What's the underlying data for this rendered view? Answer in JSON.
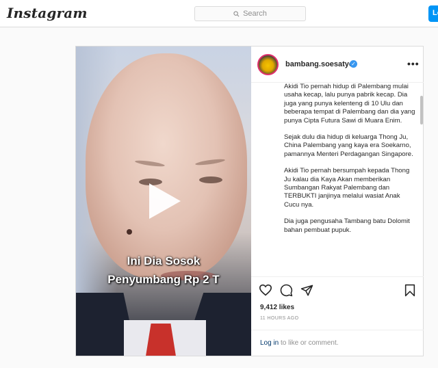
{
  "header": {
    "logo": "Instagram",
    "search_placeholder": "Search",
    "login_label": "Lo"
  },
  "post": {
    "video_overlay": {
      "line1": "Ini Dia Sosok",
      "line2": "Penyumbang Rp 2 T"
    },
    "author": {
      "username": "bambang.soesatyo",
      "verified": true
    },
    "caption_paragraphs": [
      "Akidi Tio pernah hidup di Palembang mulai usaha kecap, lalu punya pabrik kecap. Dia juga yang punya kelenteng di 10 Ulu dan beberapa tempat di Palembang dan dia yang punya Cipta Futura Sawi di Muara Enim.",
      "Sejak dulu dia hidup di keluarga Thong Ju, China Palembang yang kaya era Soekarno, pamannya Menteri Perdagangan Singapore.",
      "Akidi Tio pernah bersumpah kepada Thong Ju kalau dia Kaya Akan memberikan Sumbangan Rakyat Palembang dan TERBUKTI janjinya melalui wasiat Anak Cucu nya.",
      "Dia juga pengusaha Tambang batu Dolomit bahan pembuat pupuk."
    ],
    "likes": "9,412 likes",
    "timestamp": "11 HOURS AGO",
    "comment_prompt": {
      "login_link": "Log in",
      "rest": " to like or comment."
    },
    "icons": [
      "heart-icon",
      "comment-icon",
      "share-icon",
      "bookmark-icon",
      "more-icon",
      "play-icon",
      "search-icon"
    ]
  },
  "colors": {
    "accent": "#0095f6",
    "verified": "#3897f0",
    "link": "#00376b",
    "tie": "#c8312b"
  }
}
